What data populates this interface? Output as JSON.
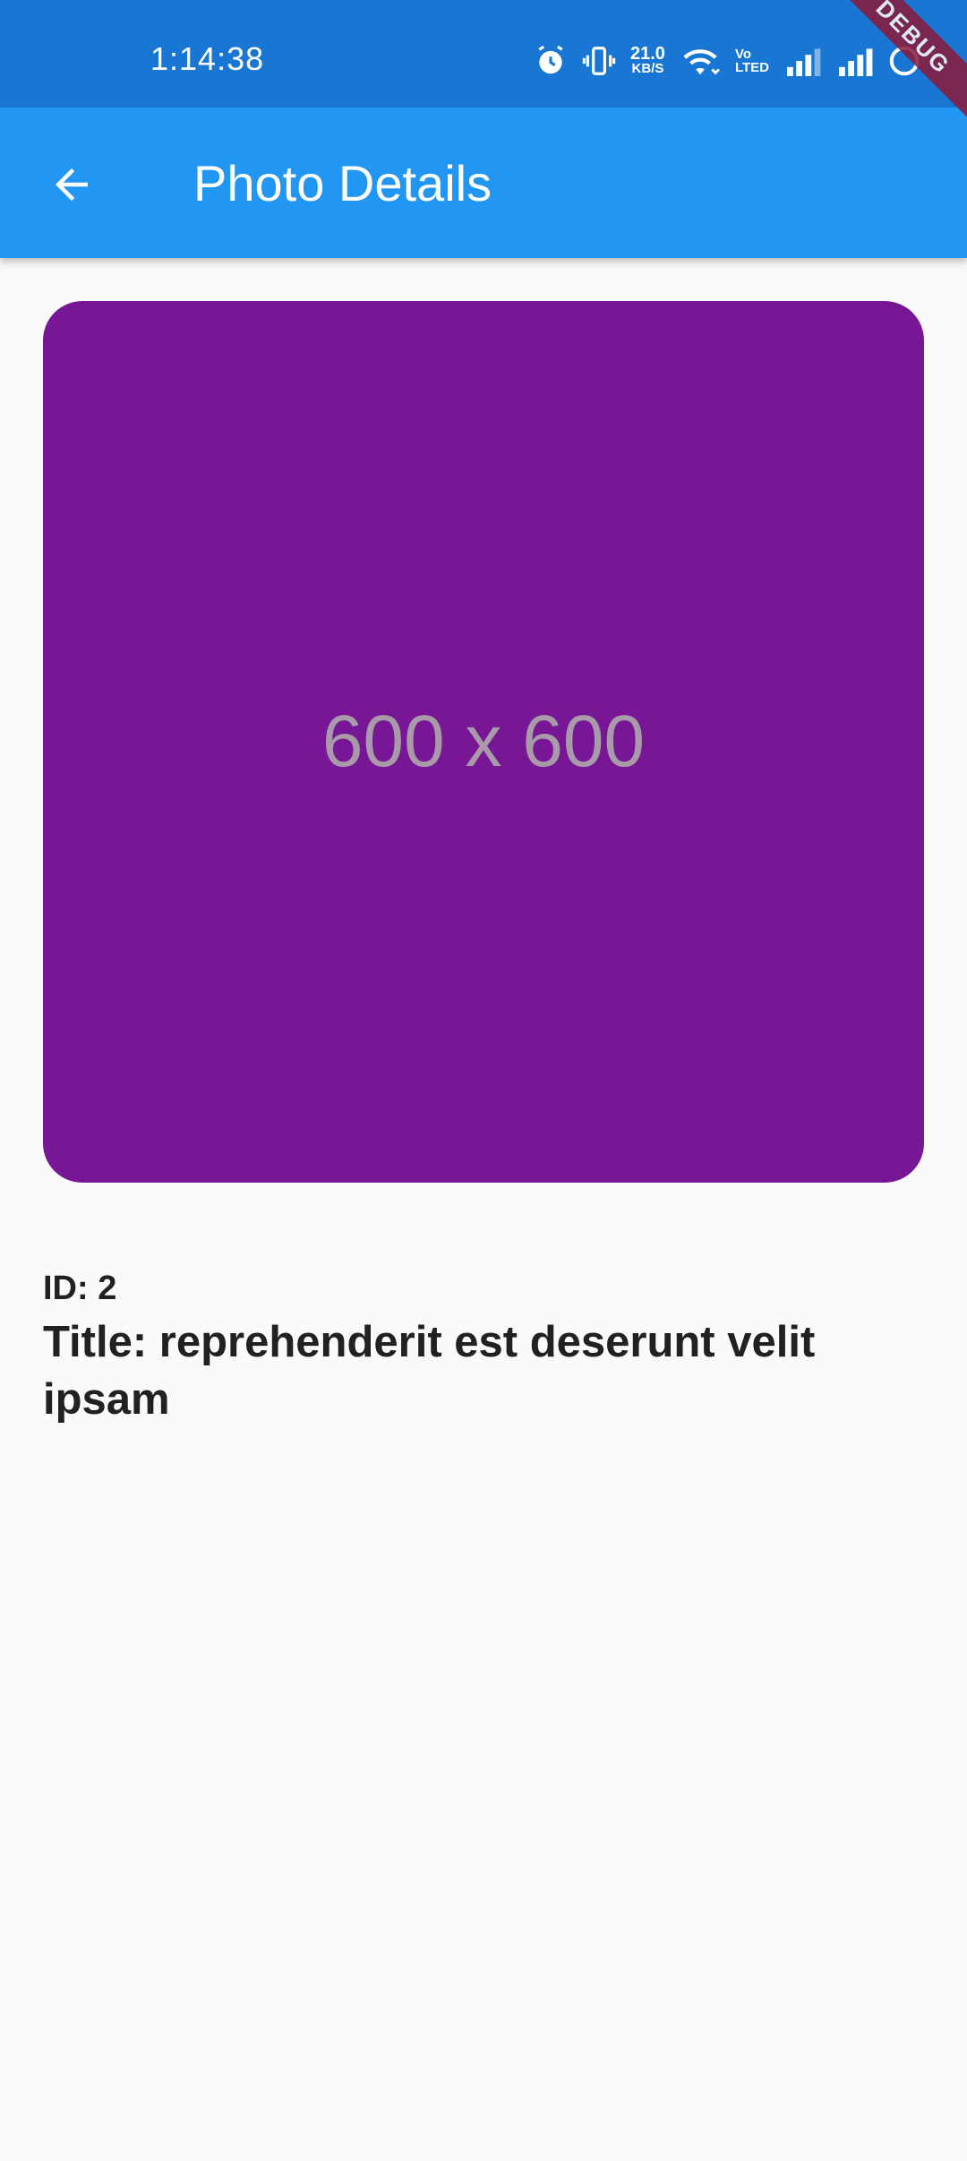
{
  "status_bar": {
    "time": "1:14:38",
    "net_speed_value": "21.0",
    "net_speed_unit": "KB/S",
    "volte_top": "Vo",
    "volte_bottom": "LTED",
    "debug_label": "DEBUG",
    "icons": [
      "alarm-icon",
      "vibrate-icon",
      "wifi-icon",
      "volte-icon",
      "signal-icon",
      "signal-icon",
      "battery-icon"
    ]
  },
  "app_bar": {
    "title": "Photo Details",
    "back_icon": "arrow-back-icon"
  },
  "photo": {
    "placeholder_text": "600 x 600",
    "background_color": "#771796"
  },
  "details": {
    "id_line": "ID: 2",
    "title_line": "Title: reprehenderit est deserunt velit ipsam"
  },
  "colors": {
    "status_bar": "#1976d2",
    "app_bar": "#2196f3",
    "page_background": "#fafafa",
    "text": "#212121"
  }
}
